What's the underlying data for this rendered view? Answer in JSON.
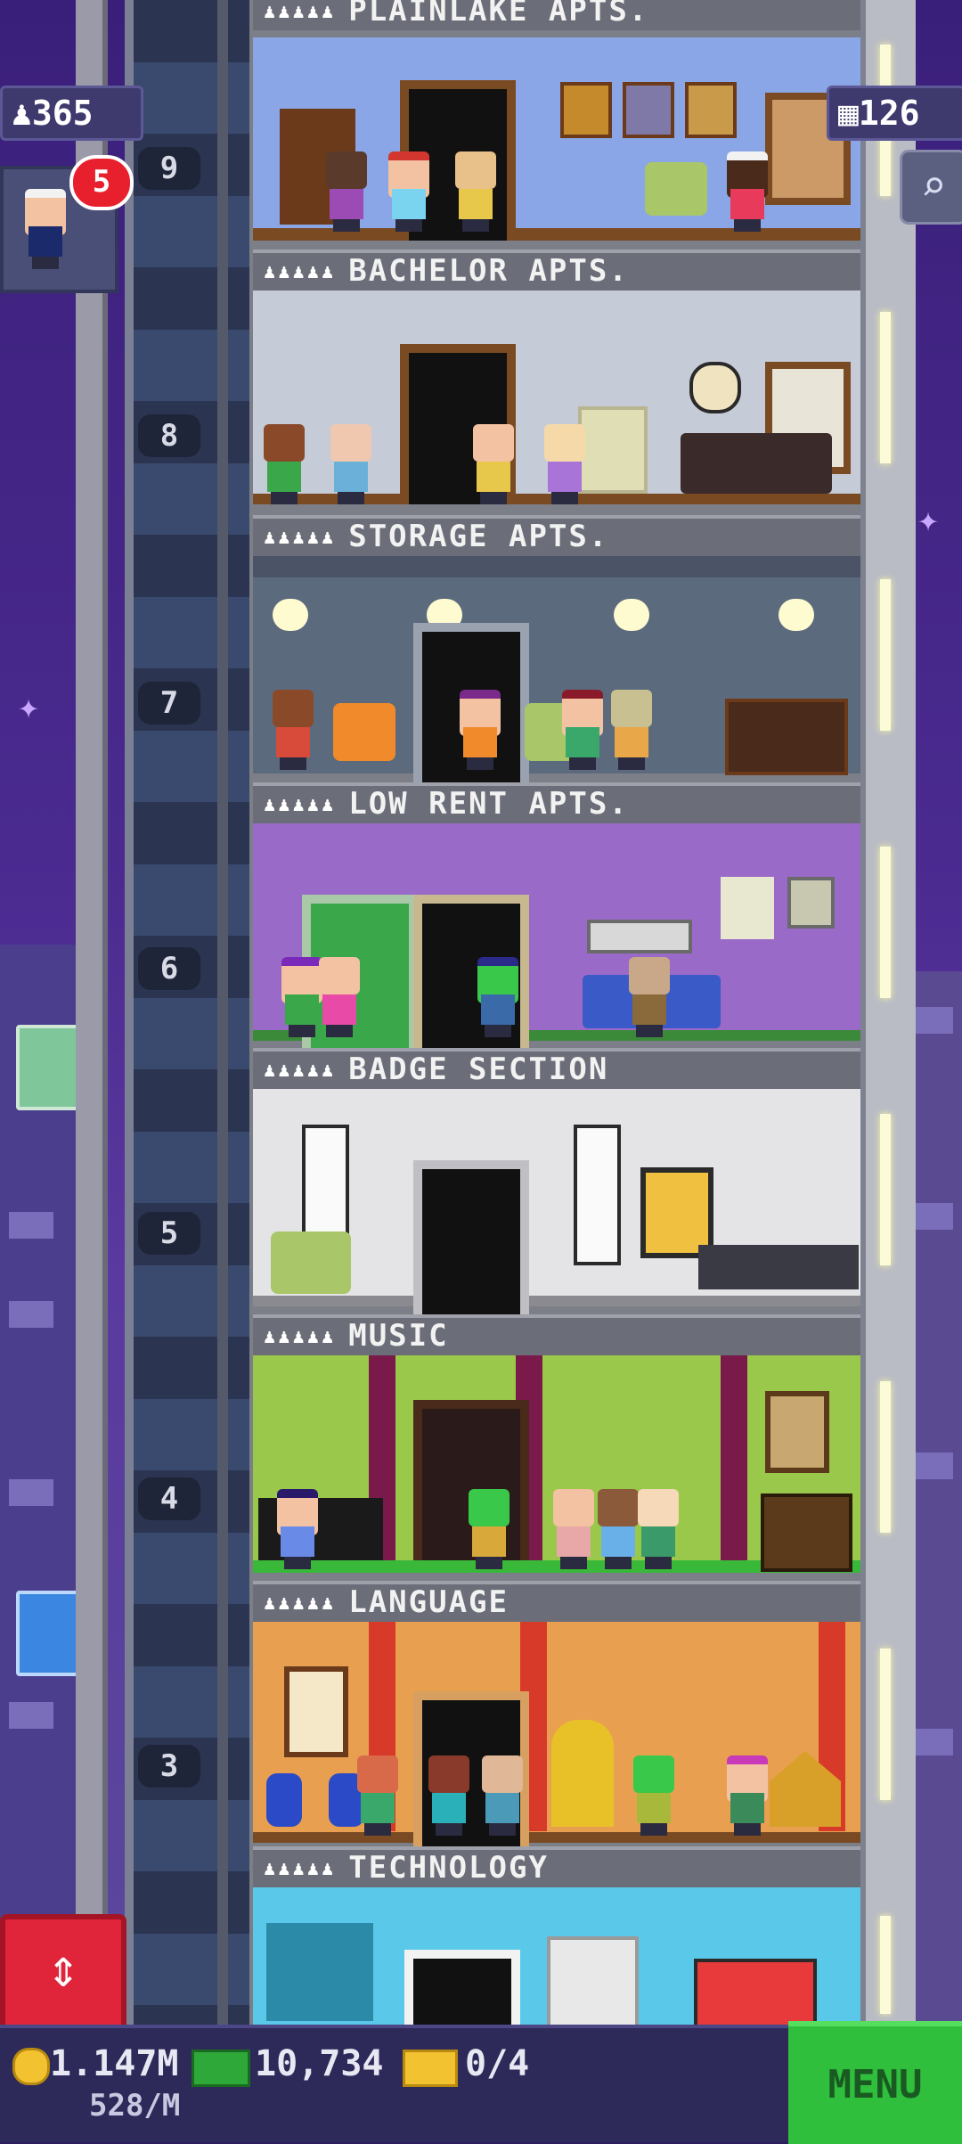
{
  "hud": {
    "population": "365",
    "floors": "126",
    "notification_count": "5"
  },
  "floors": [
    {
      "number": "9",
      "name": "PLAINLAKE APTS."
    },
    {
      "number": "8",
      "name": "BACHELOR APTS."
    },
    {
      "number": "7",
      "name": "STORAGE APTS."
    },
    {
      "number": "6",
      "name": "LOW RENT APTS."
    },
    {
      "number": "5",
      "name": "BADGE SECTION"
    },
    {
      "number": "4",
      "name": "MUSIC"
    },
    {
      "number": "3",
      "name": "LANGUAGE"
    },
    {
      "number": "",
      "name": "TECHNOLOGY"
    }
  ],
  "bottom": {
    "coins": "1.147M",
    "coins_rate": "528/M",
    "bux": "10,734",
    "tickets": "0/4",
    "menu_label": "MENU"
  },
  "colors": {
    "sky": "#3a1f7a",
    "menu_green": "#2fbf3c",
    "elevator_red": "#e0243a"
  }
}
